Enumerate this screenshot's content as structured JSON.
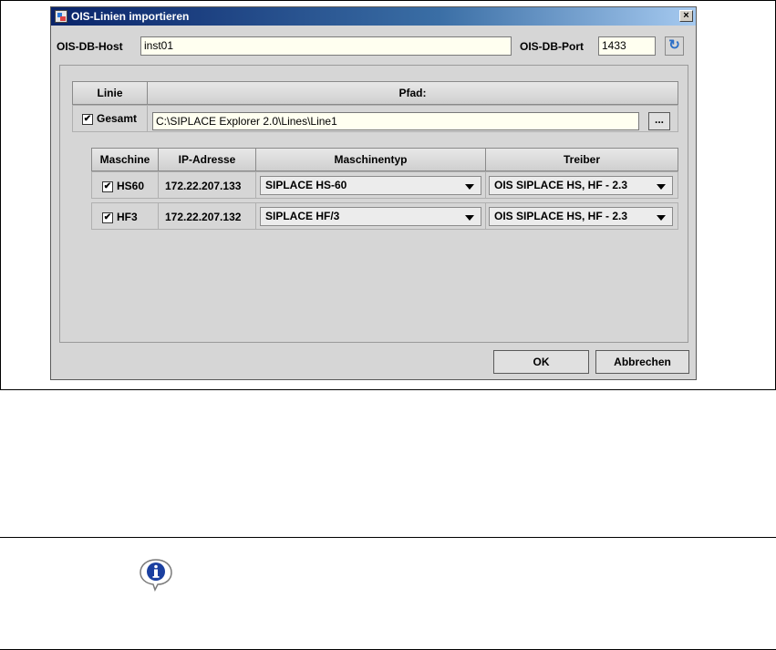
{
  "window": {
    "title": "OIS-Linien importieren",
    "close_glyph": "×"
  },
  "host": {
    "label": "OIS-DB-Host",
    "value": "inst01"
  },
  "port": {
    "label": "OIS-DB-Port",
    "value": "1433"
  },
  "line_table": {
    "headers": [
      "Linie",
      "Pfad:"
    ],
    "row": {
      "checked": true,
      "name": "Gesamt",
      "path": "C:\\SIPLACE Explorer 2.0\\Lines\\Line1",
      "browse_label": "..."
    }
  },
  "machine_table": {
    "headers": [
      "Maschine",
      "IP-Adresse",
      "Maschinentyp",
      "Treiber"
    ],
    "rows": [
      {
        "checked": true,
        "machine": "HS60",
        "ip": "172.22.207.133",
        "type": "SIPLACE HS-60",
        "driver": "OIS SIPLACE HS, HF - 2.3"
      },
      {
        "checked": true,
        "machine": "HF3",
        "ip": "172.22.207.132",
        "type": "SIPLACE HF/3",
        "driver": "OIS SIPLACE HS, HF - 2.3"
      }
    ]
  },
  "buttons": {
    "ok": "OK",
    "cancel": "Abbrechen"
  },
  "icons": {
    "refresh": "refresh-icon",
    "info": "info-icon",
    "app": "app-icon",
    "checkbox": "✔"
  },
  "colors": {
    "titlebar_start": "#0a246a",
    "dialog_bg": "#d6d6d6",
    "field_bg": "#fffff0",
    "info_blue": "#1a3fa0"
  }
}
